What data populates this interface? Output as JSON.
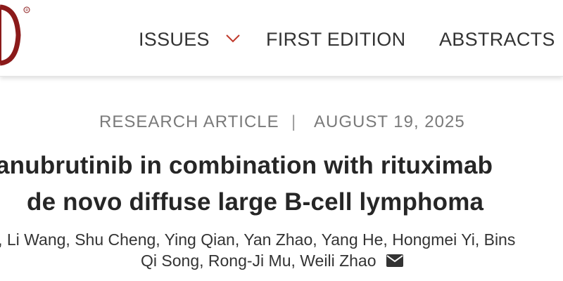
{
  "header": {
    "nav": [
      {
        "label": "ISSUES",
        "icon": "chevron-down-icon"
      },
      {
        "label": "FIRST EDITION"
      },
      {
        "label": "ABSTRACTS"
      }
    ],
    "accent_color": "#c0392b",
    "logo_color": "#8b1a1a"
  },
  "article": {
    "type": "RESEARCH ARTICLE",
    "separator": "|",
    "date": "AUGUST 19, 2025",
    "title_line1": "anubrutinib in combination with rituximab",
    "title_line2": "de novo diffuse large B-cell lymphoma",
    "authors_line1": [
      "i,",
      "Li Wang,",
      "Shu Cheng,",
      "Ying Qian,",
      "Yan Zhao,",
      "Yang He,",
      "Hongmei Yi,",
      "Bins"
    ],
    "authors_line2": [
      "Qi Song,",
      "Rong-Ji Mu,",
      "Weili Zhao"
    ],
    "contact_icon": "envelope-icon"
  }
}
